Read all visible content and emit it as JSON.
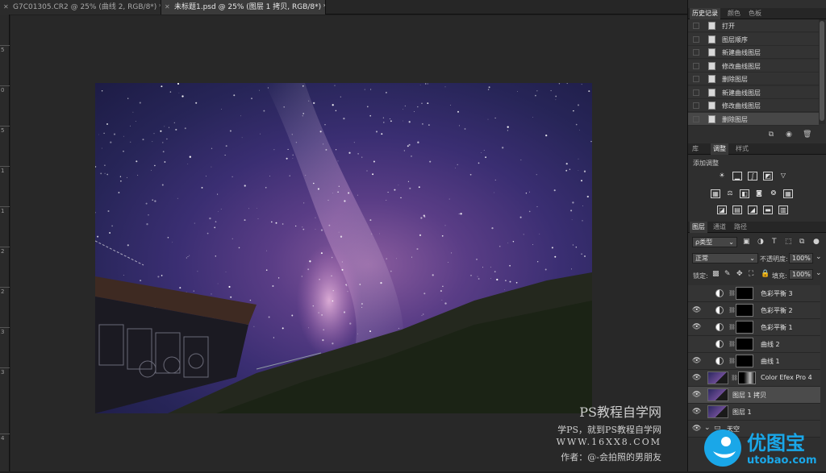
{
  "tabs": [
    {
      "label": "G7C01305.CR2 @ 25% (曲线 2, RGB/8*) *",
      "active": false
    },
    {
      "label": "未标题1.psd @ 25% (图层 1 拷贝, RGB/8*) *",
      "active": true
    }
  ],
  "ruler_left": [
    "5",
    "0",
    "5",
    "1",
    "1",
    "2",
    "2",
    "3",
    "3",
    "4"
  ],
  "history_panel": {
    "tabs": [
      "历史记录",
      "颜色",
      "色板"
    ],
    "items": [
      "打开",
      "图层顺序",
      "新建曲线图层",
      "修改曲线图层",
      "删除图层",
      "新建曲线图层",
      "修改曲线图层",
      "删除图层"
    ]
  },
  "adjust_panel": {
    "tabs": [
      "库",
      "调整",
      "样式"
    ],
    "title": "添加调整"
  },
  "layers_panel": {
    "tabs": [
      "图层",
      "通道",
      "路径"
    ],
    "filter_label": "ρ类型",
    "blend_mode": "正常",
    "opacity_label": "不透明度:",
    "opacity_value": "100%",
    "lock_label": "锁定:",
    "fill_label": "填充:",
    "fill_value": "100%",
    "layers": [
      {
        "name": "色彩平衡 3",
        "type": "adjust",
        "visible": false
      },
      {
        "name": "色彩平衡 2",
        "type": "adjust",
        "visible": true
      },
      {
        "name": "色彩平衡 1",
        "type": "adjust",
        "visible": true
      },
      {
        "name": "曲线 2",
        "type": "adjust",
        "visible": false
      },
      {
        "name": "曲线 1",
        "type": "adjust",
        "visible": true
      },
      {
        "name": "Color Efex Pro 4",
        "type": "pixel-mask",
        "visible": true
      },
      {
        "name": "图层 1 拷贝",
        "type": "pixel",
        "visible": true,
        "active": true
      },
      {
        "name": "图层 1",
        "type": "pixel",
        "visible": true
      },
      {
        "name": "天空",
        "type": "group",
        "visible": true
      }
    ]
  },
  "watermark": {
    "line1": "PS教程自学网",
    "line2": "学PS，就到PS教程自学网",
    "line3": "WWW.16XX8.COM",
    "line4": "作者：@-会拍照的男朋友"
  },
  "logo": {
    "name": "优图宝",
    "url_text": "utobao.com"
  },
  "colors": {
    "accent": "#1aa7e8",
    "panel_bg": "#2f2f2f",
    "canvas_bg": "#282828"
  }
}
